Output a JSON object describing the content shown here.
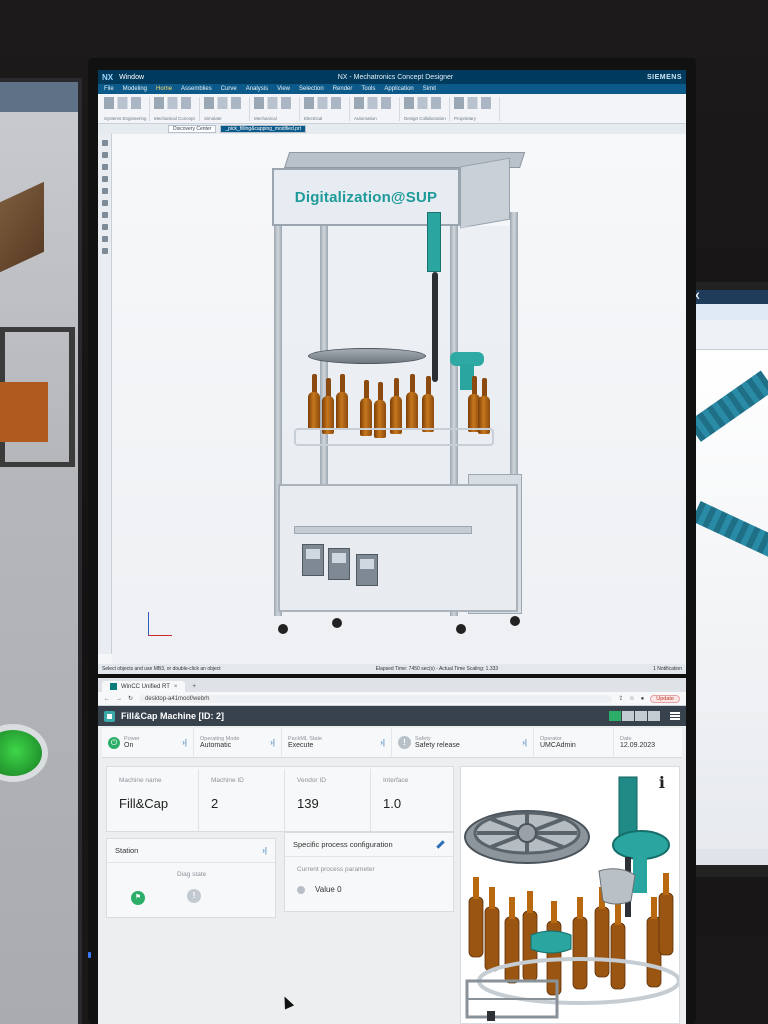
{
  "nx": {
    "logo": "NX",
    "window_menu": "Window",
    "title": "NX - Mechatronics Concept Designer",
    "brand": "SIEMENS",
    "menu": [
      "File",
      "Modeling",
      "Home",
      "Assemblies",
      "Curve",
      "Analysis",
      "View",
      "Selection",
      "Render",
      "Tools",
      "Application",
      "Simit"
    ],
    "active_menu": "Home",
    "ribbon_groups": [
      "Systems Engineering",
      "Mechanical Concept",
      "Simulate",
      "Mechanical",
      "Electrical",
      "Automation",
      "Design Collaboration",
      "Proprietary"
    ],
    "tabs": [
      "Discovery Center",
      "_pick_filling&capping_modified.prt"
    ],
    "sign_text": "Digitalization@SUP",
    "status_left": "Select objects and use MB3, or double-click an object",
    "status_mid": "Elapsed Time: 7450 sec(s) - Actual Time Scaling: 1.333",
    "status_right": "1 Notification"
  },
  "browser": {
    "tab_title": "WinCC Unified RT",
    "url": "desktop-a41moof/webrh",
    "update_label": "Update"
  },
  "app": {
    "title": "Fill&Cap Machine [ID: 2]",
    "status": [
      {
        "label": "Power",
        "value": "On"
      },
      {
        "label": "Operating Mode",
        "value": "Automatic"
      },
      {
        "label": "PackML State",
        "value": "Execute"
      },
      {
        "label": "Safety",
        "value": "Safety release"
      },
      {
        "label": "Operator",
        "value": "UMCAdmin"
      },
      {
        "label": "Date",
        "value": "12.09.2023"
      }
    ],
    "tiles": [
      {
        "label": "Machine name",
        "value": "Fill&Cap"
      },
      {
        "label": "Machine ID",
        "value": "2"
      },
      {
        "label": "Vendor ID",
        "value": "139"
      },
      {
        "label": "Interface",
        "value": "1.0"
      }
    ],
    "station": {
      "title": "Station",
      "diag_label": "Diag state"
    },
    "process": {
      "title": "Specific process configuration",
      "param_label": "Current process parameter",
      "param_value": "Value 0"
    },
    "info_glyph": "i"
  },
  "right_monitor": {
    "logo": "NX"
  },
  "colors": {
    "accent": "#1e9a9a",
    "ok": "#2cae68",
    "header": "#37424d",
    "nx_blue": "#003a5d"
  }
}
